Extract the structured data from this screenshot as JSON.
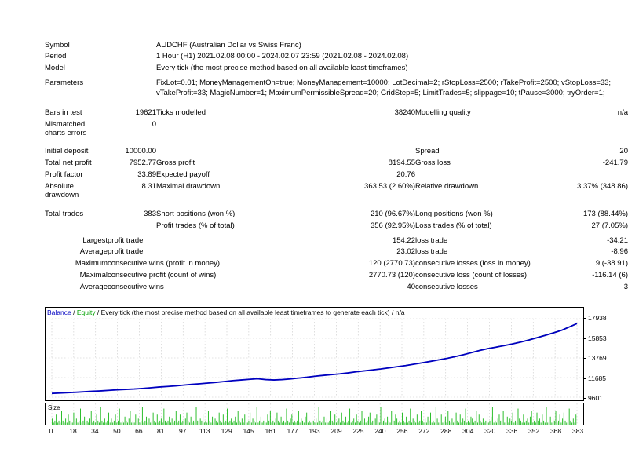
{
  "report": {
    "rows": [
      {
        "label": "Symbol",
        "value": "",
        "text": "AUDCHF (Australian Dollar vs Swiss Franc)"
      },
      {
        "label": "Period",
        "value": "",
        "text": "1 Hour (H1) 2021.02.08 00:00 - 2024.02.07 23:59 (2021.02.08 - 2024.02.08)"
      },
      {
        "label": "Model",
        "value": "",
        "text": "Every tick (the most precise method based on all available least timeframes)"
      }
    ],
    "parameters": {
      "label": "Parameters",
      "line1": "FixLot=0.01; MoneyManagementOn=true; MoneyManagement=10000; LotDecimal=2; rStopLoss=2500; rTakeProfit=2500; vStopLoss=33;",
      "line2": "vTakeProfit=33; MagicNumber=1; MaximumPermissibleSpread=20; GridStep=5; LimitTrades=5; slippage=10; tPause=3000; tryOrder=1;"
    },
    "bars_in_test": {
      "label": "Bars in test",
      "value": "19621"
    },
    "ticks_modelled": {
      "label": "Ticks modelled",
      "value": "38240"
    },
    "modelling_quality": {
      "label": "Modelling quality",
      "value": "n/a"
    },
    "mismatched": {
      "label_line1": "Mismatched",
      "label_line2": "charts errors",
      "value": "0"
    },
    "initial_deposit": {
      "label": "Initial deposit",
      "value": "10000.00"
    },
    "spread": {
      "label": "Spread",
      "value": "20"
    },
    "total_net_profit": {
      "label": "Total net profit",
      "value": "7952.77"
    },
    "gross_profit": {
      "label": "Gross profit",
      "value": "8194.55"
    },
    "gross_loss": {
      "label": "Gross loss",
      "value": "-241.79"
    },
    "profit_factor": {
      "label": "Profit factor",
      "value": "33.89"
    },
    "expected_payoff": {
      "label": "Expected payoff",
      "value": "20.76"
    },
    "absolute_drawdown": {
      "label_line1": "Absolute",
      "label_line2": "drawdown",
      "value": "8.31"
    },
    "maximal_drawdown": {
      "label": "Maximal drawdown",
      "value": "363.53 (2.60%)"
    },
    "relative_drawdown": {
      "label": "Relative drawdown",
      "value": "3.37% (348.86)"
    },
    "total_trades": {
      "label": "Total trades",
      "value": "383"
    },
    "short_positions": {
      "label": "Short positions (won %)",
      "value": "210 (96.67%)"
    },
    "long_positions": {
      "label": "Long positions (won %)",
      "value": "173 (88.44%)"
    },
    "profit_trades": {
      "label": "Profit trades (% of total)",
      "value": "356 (92.95%)"
    },
    "loss_trades": {
      "label": "Loss trades (% of total)",
      "value": "27 (7.05%)"
    },
    "largest": {
      "qualifier": "Largest",
      "left_label": "profit trade",
      "left_value": "154.22",
      "right_label": "loss trade",
      "right_value": "-34.21"
    },
    "average": {
      "qualifier": "Average",
      "left_label": "profit trade",
      "left_value": "23.02",
      "right_label": "loss trade",
      "right_value": "-8.96"
    },
    "maximum": {
      "qualifier": "Maximum",
      "left_label": "consecutive wins (profit in money)",
      "left_value": "120 (2770.73)",
      "right_label": "consecutive losses (loss in money)",
      "right_value": "9 (-38.91)"
    },
    "maximal": {
      "qualifier": "Maximal",
      "left_label": "consecutive profit (count of wins)",
      "left_value": "2770.73 (120)",
      "right_label": "consecutive loss (count of losses)",
      "right_value": "-116.14 (6)"
    },
    "average_consec": {
      "qualifier": "Average",
      "left_label": "consecutive wins",
      "left_value": "40",
      "right_label": "consecutive losses",
      "right_value": "3"
    }
  },
  "chart_data": {
    "type": "line",
    "title": "",
    "legend": {
      "balance": "Balance",
      "equity": "Equity",
      "sep": "/",
      "description": "Every tick (the most precise method based on all available least timeframes to generate each tick) / n/a",
      "balance_color": "#0000c0",
      "equity_color": "#00a000"
    },
    "xlabel": "",
    "ylabel": "",
    "ylim": [
      9601,
      17938
    ],
    "yticks": [
      "17938",
      "15853",
      "13769",
      "11685",
      "9601"
    ],
    "xticks": [
      "0",
      "18",
      "34",
      "50",
      "66",
      "81",
      "97",
      "113",
      "129",
      "145",
      "161",
      "177",
      "193",
      "209",
      "225",
      "240",
      "256",
      "272",
      "288",
      "304",
      "320",
      "336",
      "352",
      "368",
      "383"
    ],
    "grid": true,
    "series": [
      {
        "name": "Balance",
        "color": "#0000c0",
        "x": [
          0,
          6,
          12,
          18,
          24,
          30,
          36,
          42,
          48,
          54,
          60,
          66,
          72,
          78,
          84,
          90,
          96,
          102,
          108,
          114,
          120,
          126,
          132,
          138,
          144,
          150,
          156,
          162,
          168,
          174,
          180,
          186,
          192,
          198,
          204,
          210,
          216,
          222,
          228,
          234,
          240,
          246,
          252,
          258,
          264,
          270,
          276,
          282,
          288,
          294,
          300,
          306,
          312,
          318,
          324,
          330,
          336,
          342,
          348,
          354,
          360,
          366,
          372,
          378,
          383
        ],
        "values": [
          10000,
          10040,
          10085,
          10125,
          10180,
          10230,
          10275,
          10330,
          10390,
          10430,
          10470,
          10530,
          10600,
          10680,
          10740,
          10800,
          10880,
          10960,
          11030,
          11100,
          11180,
          11270,
          11360,
          11430,
          11500,
          11560,
          11470,
          11430,
          11470,
          11540,
          11630,
          11720,
          11830,
          11920,
          12000,
          12080,
          12180,
          12300,
          12400,
          12500,
          12600,
          12720,
          12840,
          12960,
          13100,
          13250,
          13400,
          13560,
          13720,
          13900,
          14100,
          14330,
          14560,
          14760,
          14920,
          15080,
          15260,
          15460,
          15680,
          15930,
          16180,
          16440,
          16720,
          17100,
          17420
        ]
      },
      {
        "name": "Equity",
        "color": "#00a000",
        "x": [
          0,
          6,
          12,
          18,
          24,
          30,
          36,
          42,
          48,
          54,
          60,
          66,
          72,
          78,
          84,
          90,
          96,
          102,
          108,
          114,
          120,
          126,
          132,
          138,
          144,
          150,
          156,
          162,
          168,
          174,
          180,
          186,
          192,
          198,
          204,
          210,
          216,
          222,
          228,
          234,
          240,
          246,
          252,
          258,
          264,
          270,
          276,
          282,
          288,
          294,
          300,
          306,
          312,
          318,
          324,
          330,
          336,
          342,
          348,
          354,
          360,
          366,
          372,
          378,
          383
        ],
        "values": [
          10000,
          10045,
          10090,
          10135,
          10190,
          10240,
          10285,
          10340,
          10400,
          10440,
          10480,
          10545,
          10615,
          10695,
          10755,
          10815,
          10895,
          10975,
          11045,
          11115,
          11195,
          11285,
          11375,
          11445,
          11515,
          11575,
          11485,
          11445,
          11485,
          11555,
          11645,
          11735,
          11845,
          11935,
          12015,
          12095,
          12200,
          12320,
          12420,
          12520,
          12620,
          12740,
          12860,
          12980,
          13120,
          13270,
          13420,
          13580,
          13745,
          13925,
          14125,
          14355,
          14585,
          14785,
          14945,
          15105,
          15285,
          15485,
          15710,
          15960,
          16210,
          16470,
          16750,
          17130,
          17440
        ]
      }
    ]
  },
  "volume_chart": {
    "type": "bar",
    "label": "Size",
    "color": "#22bb22",
    "values": [
      3,
      1,
      2,
      5,
      1,
      2,
      1,
      7,
      2,
      1,
      3,
      1,
      5,
      2,
      1,
      1,
      6,
      2,
      3,
      1,
      2,
      8,
      1,
      2,
      4,
      1,
      2,
      1,
      3,
      7,
      1,
      2,
      1,
      5,
      2,
      1,
      9,
      2,
      1,
      3,
      1,
      2,
      6,
      1,
      3,
      1,
      2,
      5,
      1,
      2,
      8,
      1,
      2,
      1,
      4,
      2,
      1,
      3,
      7,
      1,
      2,
      1,
      5,
      2,
      3,
      1,
      2,
      9,
      1,
      2,
      4,
      1,
      3,
      1,
      2,
      6,
      2,
      1,
      5,
      1,
      2,
      3,
      1,
      8,
      2,
      1,
      2,
      4,
      1,
      3,
      1,
      2,
      7,
      1,
      2,
      5,
      1,
      2,
      1,
      3,
      6,
      2,
      1,
      4,
      1,
      2,
      1,
      9,
      2,
      1,
      3,
      2,
      5,
      1,
      2,
      1,
      7,
      2,
      1,
      4,
      1,
      3,
      2,
      1,
      6,
      2,
      1,
      5,
      1,
      2,
      8,
      1,
      2,
      3,
      1,
      2,
      4,
      1,
      7,
      2,
      1,
      3,
      1,
      5,
      2,
      1,
      2,
      6,
      1,
      3,
      2,
      1,
      9,
      1,
      2,
      4,
      1,
      2,
      3,
      1,
      5,
      2,
      7,
      1,
      2,
      1,
      3,
      6,
      2,
      1,
      4,
      1,
      2,
      1,
      8,
      2,
      1,
      3,
      5,
      1,
      2,
      1,
      2,
      7,
      1,
      3,
      2,
      1,
      4,
      6,
      1,
      2,
      1,
      5,
      2,
      1,
      3,
      1,
      9,
      2,
      1,
      2,
      4,
      1,
      3,
      1,
      2,
      7,
      2,
      1,
      5,
      1,
      2,
      3,
      1,
      6,
      2,
      1,
      4,
      1,
      2,
      8,
      1,
      2,
      3,
      1,
      5,
      2,
      1,
      2,
      7,
      1,
      3,
      1,
      2,
      4,
      6,
      1,
      2,
      1,
      3,
      5,
      2,
      1,
      9,
      1,
      2,
      3,
      1,
      4,
      2,
      1,
      7,
      1,
      2,
      5,
      3,
      1,
      2,
      1,
      6,
      2,
      1,
      4,
      1,
      2,
      8,
      1,
      3,
      2,
      1,
      5,
      1,
      2,
      7,
      2,
      1,
      3,
      1,
      4,
      2,
      6,
      1,
      2,
      1,
      9,
      3,
      1,
      2,
      5,
      1,
      2,
      4,
      1,
      7,
      2,
      1,
      3,
      1,
      2,
      6,
      2,
      1,
      5,
      1,
      3,
      2,
      8,
      1,
      2,
      1,
      4,
      3,
      1,
      2,
      7,
      1,
      5,
      2,
      1,
      3,
      1,
      2,
      6,
      1,
      2,
      4,
      9,
      1,
      2,
      1,
      3,
      5,
      2,
      1,
      7,
      1,
      2,
      4,
      1,
      3,
      2,
      6,
      1,
      2,
      1,
      8,
      3,
      2,
      1,
      5,
      1,
      2,
      3,
      1,
      4,
      7,
      1,
      2,
      1,
      6,
      2,
      3,
      1,
      5,
      2,
      1,
      9,
      1,
      2,
      4,
      1,
      3,
      2,
      7,
      1,
      2,
      5,
      1,
      3,
      6,
      2,
      1,
      4,
      8,
      2,
      1,
      3,
      1,
      5
    ]
  }
}
